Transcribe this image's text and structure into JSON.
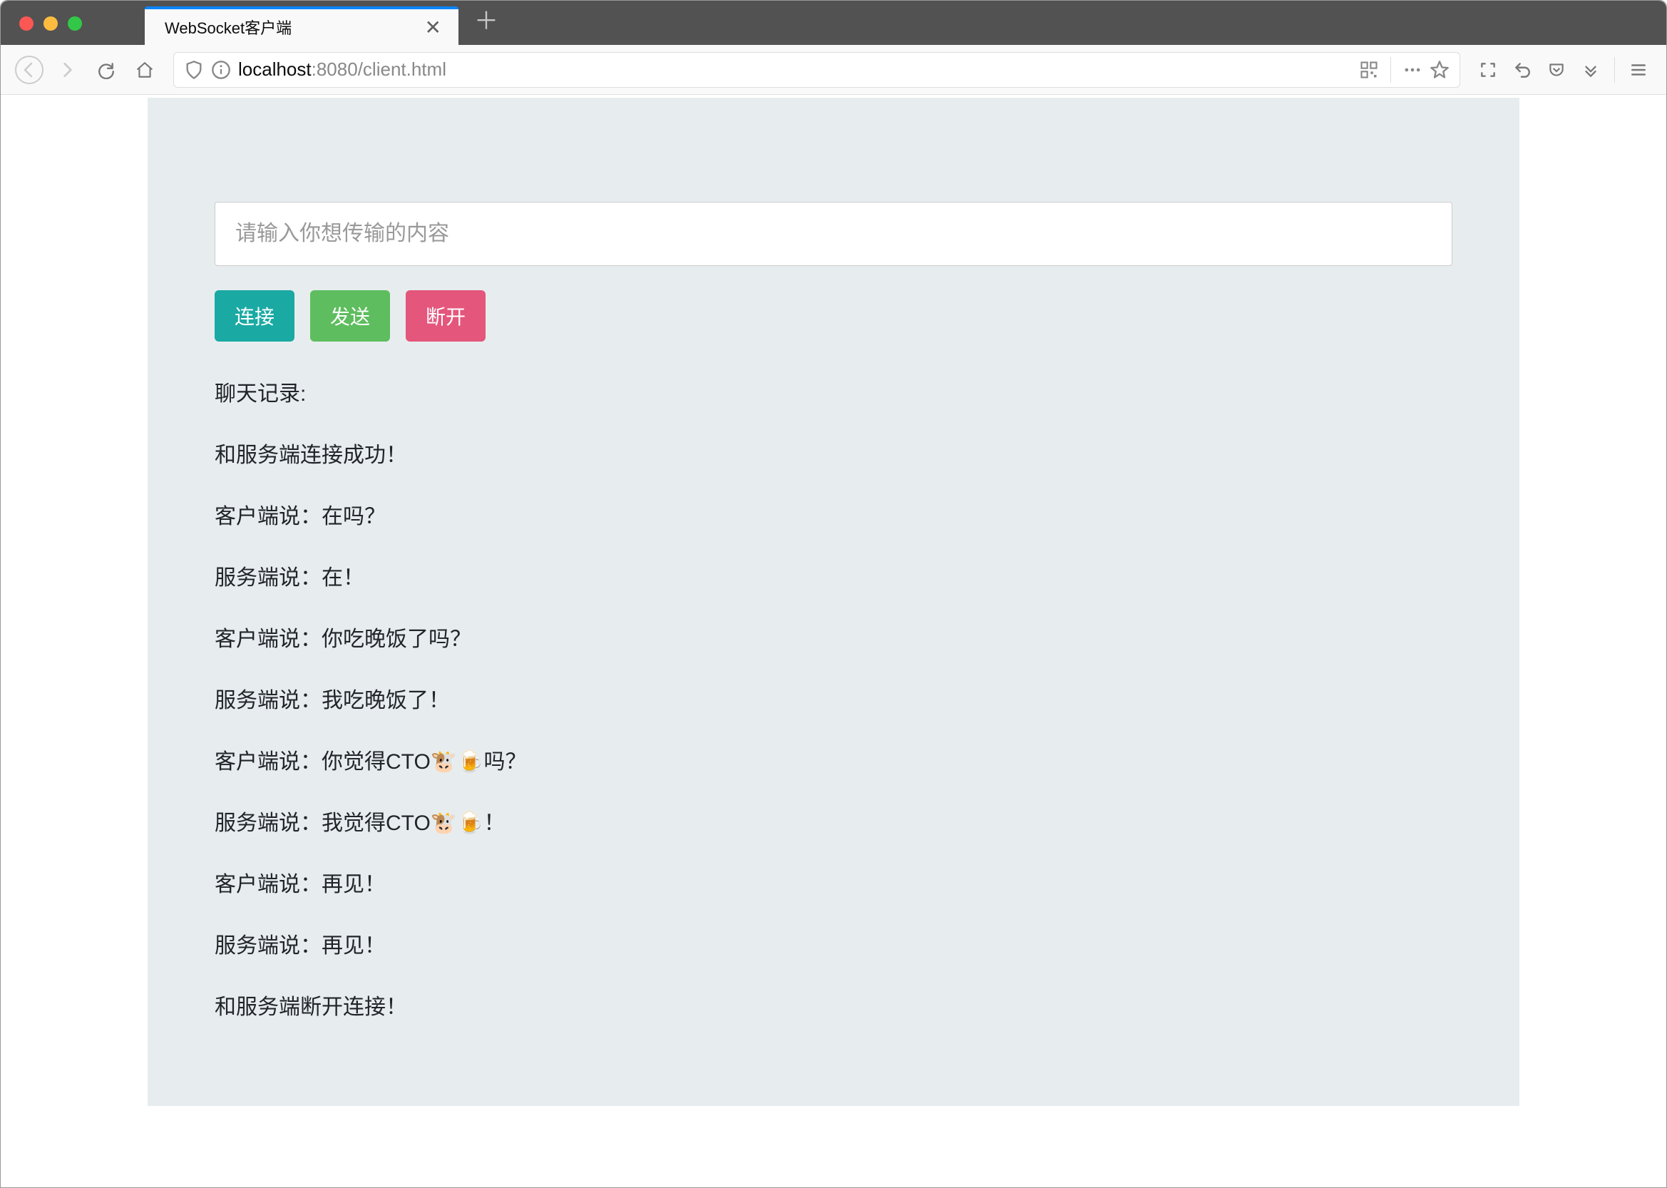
{
  "browser": {
    "tab_title": "WebSocket客户端",
    "url_host": "localhost",
    "url_port": ":8080",
    "url_path": "/client.html"
  },
  "page": {
    "input_placeholder": "请输入你想传输的内容",
    "buttons": {
      "connect": "连接",
      "send": "发送",
      "disconnect": "断开"
    },
    "log_title": "聊天记录:",
    "log": [
      "和服务端连接成功！",
      "客户端说：在吗？",
      "服务端说：在！",
      "客户端说：你吃晚饭了吗？",
      "服务端说：我吃晚饭了！",
      "客户端说：你觉得CTO🐮🍺吗？",
      "服务端说：我觉得CTO🐮🍺！",
      "客户端说：再见！",
      "服务端说：再见！",
      "和服务端断开连接！"
    ]
  }
}
